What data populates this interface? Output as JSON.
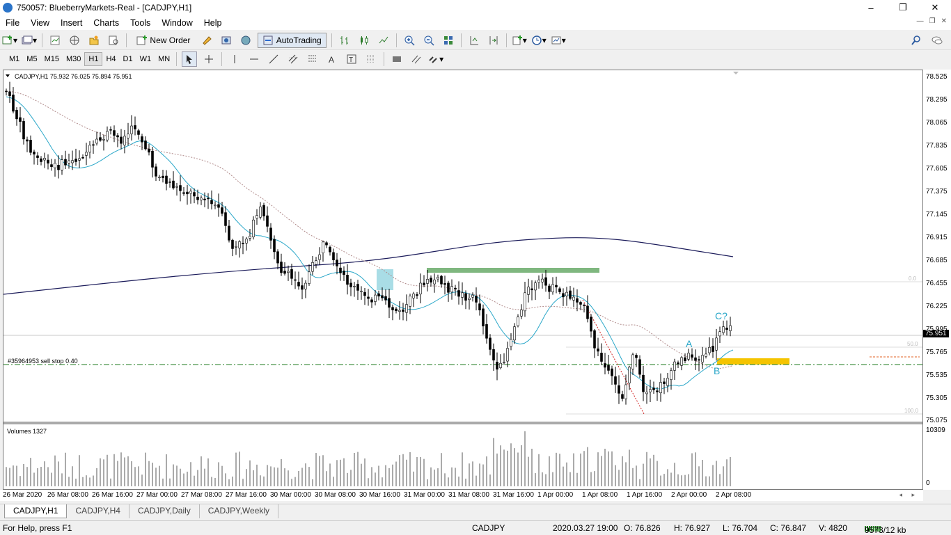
{
  "window": {
    "title": "750057: BlueberryMarkets-Real - [CADJPY,H1]",
    "min": "–",
    "max": "❐",
    "close": "✕"
  },
  "menu": [
    "File",
    "View",
    "Insert",
    "Charts",
    "Tools",
    "Window",
    "Help"
  ],
  "toolbar": {
    "new_order": "New Order",
    "autotrading": "AutoTrading"
  },
  "timeframes": [
    "M1",
    "M5",
    "M15",
    "M30",
    "H1",
    "H4",
    "D1",
    "W1",
    "MN"
  ],
  "active_timeframe": "H1",
  "chart": {
    "header": "CADJPY,H1  75.932 76.025 75.894 75.951",
    "order_label": "#35964953 sell stop 0.40",
    "volumes_label": "Volumes 1327",
    "current_price": "75.951",
    "wave_labels": {
      "a": "A",
      "b": "B",
      "c": "C?"
    },
    "fib_labels": {
      "f0": "0.0",
      "f50": "50.0",
      "f100": "100.0"
    }
  },
  "price_ticks": [
    "78.525",
    "78.295",
    "78.065",
    "77.835",
    "77.605",
    "77.375",
    "77.145",
    "76.915",
    "76.685",
    "76.455",
    "76.225",
    "75.995",
    "75.765",
    "75.535",
    "75.305",
    "75.075"
  ],
  "volume_ticks": [
    "10309",
    "0"
  ],
  "time_ticks": [
    "26 Mar 2020",
    "26 Mar 08:00",
    "26 Mar 16:00",
    "27 Mar 00:00",
    "27 Mar 08:00",
    "27 Mar 16:00",
    "30 Mar 00:00",
    "30 Mar 08:00",
    "30 Mar 16:00",
    "31 Mar 00:00",
    "31 Mar 08:00",
    "31 Mar 16:00",
    "1 Apr 00:00",
    "1 Apr 08:00",
    "1 Apr 16:00",
    "2 Apr 00:00",
    "2 Apr 08:00"
  ],
  "tabs": [
    "CADJPY,H1",
    "CADJPY,H4",
    "CADJPY,Daily",
    "CADJPY,Weekly"
  ],
  "status": {
    "help": "For Help, press F1",
    "symbol": "CADJPY",
    "datetime": "2020.03.27 19:00",
    "open": "O: 76.826",
    "high": "H: 76.927",
    "low": "L: 76.704",
    "close": "C: 76.847",
    "volume": "V: 4820",
    "traffic": "9573/12 kb"
  },
  "colors": {
    "bull": "#ffffff",
    "bear": "#000000",
    "ma_fast": "#2aa7c9",
    "ma_slow": "#1b1b5a",
    "ma_dotted": "#b08a8a",
    "green_zone": "#7fb77f",
    "blue_zone": "#a9dde6",
    "yellow_zone": "#f5c400",
    "order_line": "#1e7a1e"
  }
}
